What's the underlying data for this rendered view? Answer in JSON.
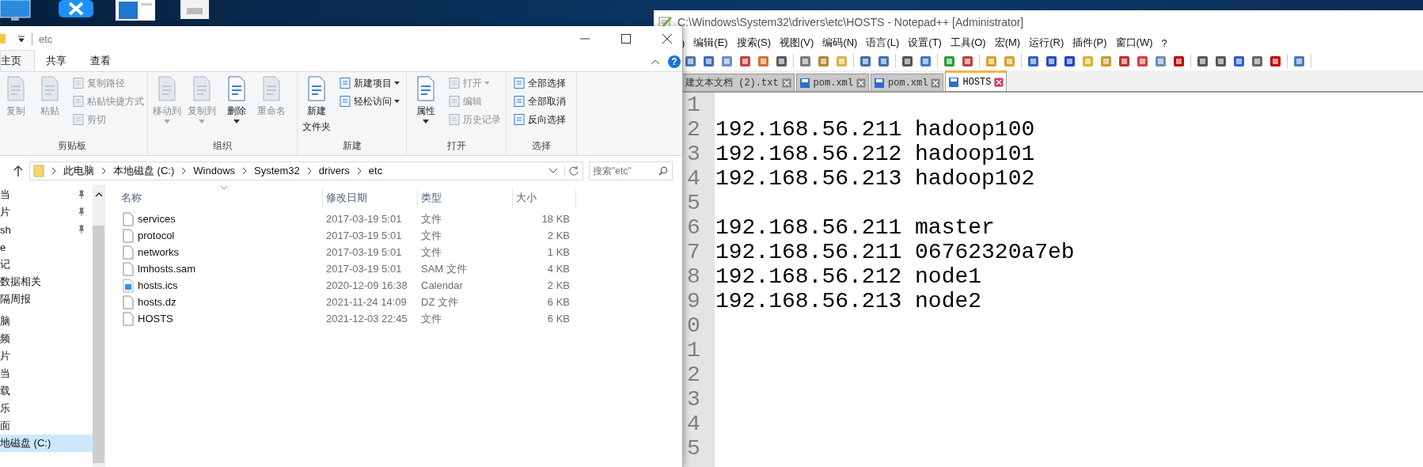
{
  "notepad": {
    "title": "C:\\Windows\\System32\\drivers\\etc\\HOSTS - Notepad++ [Administrator]",
    "menu": [
      ")",
      "编辑(E)",
      "搜索(S)",
      "视图(V)",
      "编码(N)",
      "语言(L)",
      "设置(T)",
      "工具(O)",
      "宏(M)",
      "运行(R)",
      "插件(P)",
      "窗口(W)",
      "?"
    ],
    "tabs": [
      {
        "label": "建文本文档 (2).txt",
        "selected": false,
        "has_icon": false
      },
      {
        "label": "pom.xml",
        "selected": false,
        "has_icon": true
      },
      {
        "label": "pom.xml",
        "selected": false,
        "has_icon": true
      },
      {
        "label": "HOSTS",
        "selected": true,
        "has_icon": true
      }
    ],
    "lines": [
      {
        "number": "1"
      },
      {
        "number": "2",
        "text": "192.168.56.211 hadoop100"
      },
      {
        "number": "3",
        "text": "192.168.56.212 hadoop101"
      },
      {
        "number": "4",
        "text": "192.168.56.213 hadoop102"
      },
      {
        "number": "5"
      },
      {
        "number": "6",
        "text": "192.168.56.211 master"
      },
      {
        "number": "7",
        "text": "192.168.56.211 06762320a7eb"
      },
      {
        "number": "8",
        "text": "192.168.56.212 node1"
      },
      {
        "number": "9",
        "text": "192.168.56.213 node2"
      },
      {
        "number": "0"
      },
      {
        "number": "1"
      },
      {
        "number": "2"
      },
      {
        "number": "3"
      },
      {
        "number": "4"
      },
      {
        "number": "5"
      }
    ]
  },
  "explorer": {
    "title": "etc",
    "help": "?",
    "tabs": [
      {
        "label": "主页",
        "selected": true
      },
      {
        "label": "共享",
        "selected": false
      },
      {
        "label": "查看",
        "selected": false
      }
    ],
    "ribbon": {
      "groups": [
        {
          "label": "剪贴板",
          "items": [
            {
              "label": "复制",
              "kind": "large",
              "disabled": true,
              "dropdown": false
            },
            {
              "label": "粘贴",
              "kind": "large",
              "disabled": true,
              "dropdown": false
            },
            {
              "label": "复制路径",
              "kind": "small",
              "disabled": true,
              "dropdown": false
            },
            {
              "label": "粘贴快捷方式",
              "kind": "small",
              "disabled": true,
              "dropdown": false
            },
            {
              "label": "剪切",
              "kind": "small",
              "disabled": true,
              "dropdown": false
            }
          ]
        },
        {
          "label": "组织",
          "items": [
            {
              "label": "移动到",
              "kind": "large",
              "disabled": true,
              "dropdown": true
            },
            {
              "label": "复制到",
              "kind": "large",
              "disabled": true,
              "dropdown": true
            },
            {
              "label": "删除",
              "kind": "large",
              "disabled": false,
              "dropdown": true
            },
            {
              "label": "重命名",
              "kind": "large",
              "disabled": true,
              "dropdown": false
            }
          ]
        },
        {
          "label": "新建",
          "items": [
            {
              "label": "新建",
              "label_2": "文件夹",
              "kind": "large",
              "disabled": false,
              "dropdown": false
            },
            {
              "label": "新建项目",
              "kind": "small",
              "disabled": false,
              "dropdown": true
            },
            {
              "label": "轻松访问",
              "kind": "small",
              "disabled": false,
              "dropdown": true
            }
          ]
        },
        {
          "label": "打开",
          "items": [
            {
              "label": "属性",
              "kind": "large",
              "disabled": false,
              "dropdown": true
            },
            {
              "label": "打开",
              "kind": "small",
              "disabled": true,
              "dropdown": true
            },
            {
              "label": "编辑",
              "kind": "small",
              "disabled": true,
              "dropdown": false
            },
            {
              "label": "历史记录",
              "kind": "small",
              "disabled": true,
              "dropdown": false
            }
          ]
        },
        {
          "label": "选择",
          "items": [
            {
              "label": "全部选择",
              "kind": "small",
              "disabled": false,
              "dropdown": false
            },
            {
              "label": "全部取消",
              "kind": "small",
              "disabled": false,
              "dropdown": false
            },
            {
              "label": "反向选择",
              "kind": "small",
              "disabled": false,
              "dropdown": false
            }
          ]
        }
      ]
    },
    "address": [
      "此电脑",
      "本地磁盘 (C:)",
      "Windows",
      "System32",
      "drivers",
      "etc"
    ],
    "search": {
      "placeholder": "搜索\"etc\""
    },
    "nav": {
      "groups": [
        {
          "items": [
            {
              "label": "当",
              "pinned": true,
              "selected": false
            },
            {
              "label": "片",
              "pinned": true,
              "selected": false
            },
            {
              "label": "sh",
              "pinned": true,
              "selected": false
            },
            {
              "label": "e",
              "pinned": false,
              "selected": false
            },
            {
              "label": "记",
              "pinned": false,
              "selected": false
            },
            {
              "label": "数据相关",
              "pinned": false,
              "selected": false
            },
            {
              "label": "隔周报",
              "pinned": false,
              "selected": false
            }
          ]
        },
        {
          "items": [
            {
              "label": "脑",
              "pinned": false,
              "selected": false
            },
            {
              "label": "频",
              "pinned": false,
              "selected": false
            },
            {
              "label": "片",
              "pinned": false,
              "selected": false
            },
            {
              "label": "当",
              "pinned": false,
              "selected": false
            },
            {
              "label": "载",
              "pinned": false,
              "selected": false
            },
            {
              "label": "乐",
              "pinned": false,
              "selected": false
            },
            {
              "label": "面",
              "pinned": false,
              "selected": false
            },
            {
              "label": "地磁盘 (C:)",
              "pinned": false,
              "selected": true
            }
          ]
        }
      ]
    },
    "columns": [
      "名称",
      "修改日期",
      "类型",
      "大小"
    ],
    "files": [
      {
        "name": "services",
        "date": "2017-03-19 5:01",
        "type": "文件",
        "size": "18 KB",
        "kind": "file"
      },
      {
        "name": "protocol",
        "date": "2017-03-19 5:01",
        "type": "文件",
        "size": "2 KB",
        "kind": "file"
      },
      {
        "name": "networks",
        "date": "2017-03-19 5:01",
        "type": "文件",
        "size": "1 KB",
        "kind": "file"
      },
      {
        "name": "lmhosts.sam",
        "date": "2017-03-19 5:01",
        "type": "SAM 文件",
        "size": "4 KB",
        "kind": "file"
      },
      {
        "name": "hosts.ics",
        "date": "2020-12-09 16:38",
        "type": "Calendar",
        "size": "2 KB",
        "kind": "calendar"
      },
      {
        "name": "hosts.dz",
        "date": "2021-11-24 14:09",
        "type": "DZ 文件",
        "size": "6 KB",
        "kind": "file"
      },
      {
        "name": "HOSTS",
        "date": "2021-12-03 22:45",
        "type": "文件",
        "size": "6 KB",
        "kind": "file"
      }
    ]
  }
}
